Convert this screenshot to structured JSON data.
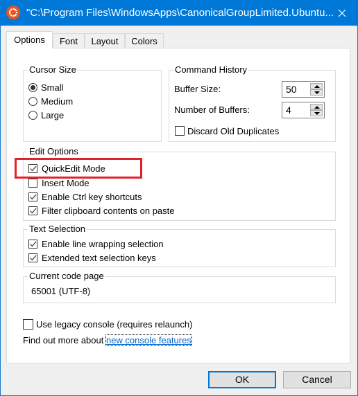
{
  "window": {
    "title": "\"C:\\Program Files\\WindowsApps\\CanonicalGroupLimited.Ubuntu...",
    "app_icon": "ubuntu-logo-icon",
    "close_icon": "close-icon",
    "titlebar_color": "#0078d7"
  },
  "tabs": [
    {
      "label": "Options",
      "selected": true
    },
    {
      "label": "Font",
      "selected": false
    },
    {
      "label": "Layout",
      "selected": false
    },
    {
      "label": "Colors",
      "selected": false
    }
  ],
  "cursor_size": {
    "legend": "Cursor Size",
    "options": [
      {
        "label": "Small",
        "selected": true
      },
      {
        "label": "Medium",
        "selected": false
      },
      {
        "label": "Large",
        "selected": false
      }
    ]
  },
  "command_history": {
    "legend": "Command History",
    "buffer_size_label": "Buffer Size:",
    "buffer_size_value": "50",
    "num_buffers_label": "Number of Buffers:",
    "num_buffers_value": "4",
    "discard_label": "Discard Old Duplicates",
    "discard_checked": false
  },
  "edit_options": {
    "legend": "Edit Options",
    "items": [
      {
        "label": "QuickEdit Mode",
        "checked": true,
        "highlighted": true
      },
      {
        "label": "Insert Mode",
        "checked": false
      },
      {
        "label": "Enable Ctrl key shortcuts",
        "checked": true
      },
      {
        "label": "Filter clipboard contents on paste",
        "checked": true
      }
    ]
  },
  "text_selection": {
    "legend": "Text Selection",
    "items": [
      {
        "label": "Enable line wrapping selection",
        "checked": true
      },
      {
        "label": "Extended text selection keys",
        "checked": true
      }
    ]
  },
  "code_page": {
    "legend": "Current code page",
    "value": "65001 (UTF-8)"
  },
  "legacy": {
    "label": "Use legacy console (requires relaunch)",
    "checked": false
  },
  "find_more": {
    "prefix": "Find out more about ",
    "link": "new console features"
  },
  "buttons": {
    "ok": "OK",
    "cancel": "Cancel"
  },
  "highlight_color": "#e3202b"
}
